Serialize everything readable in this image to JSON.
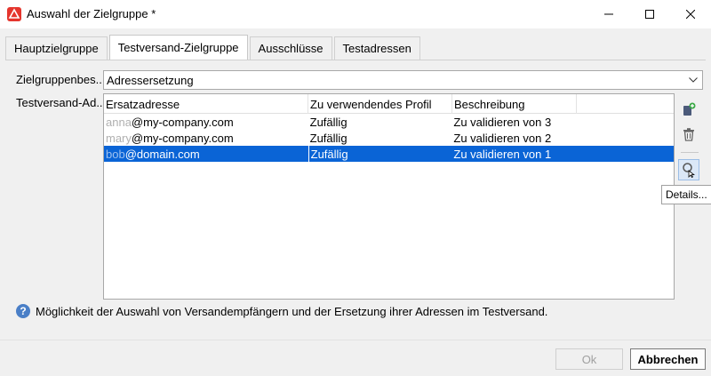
{
  "window": {
    "title": "Auswahl der Zielgruppe *",
    "logo_icon": "adobe-campaign-icon",
    "accent": "#e5352d"
  },
  "tabs": [
    {
      "label": "Hauptzielgruppe",
      "active": false
    },
    {
      "label": "Testversand-Zielgruppe",
      "active": true
    },
    {
      "label": "Ausschlüsse",
      "active": false
    },
    {
      "label": "Testadressen",
      "active": false
    }
  ],
  "form": {
    "target_label": "Zielgruppenbes...",
    "target_value": "Adressersetzung",
    "testaddress_label": "Testversand-Ad..."
  },
  "grid": {
    "columns": [
      "Ersatzadresse",
      "Zu verwendendes Profil",
      "Beschreibung"
    ],
    "rows": [
      {
        "masked": "anna",
        "domain": "@my-company.com",
        "profile": "Zufällig",
        "description": "Zu validieren von 3",
        "selected": false
      },
      {
        "masked": "mary",
        "domain": "@my-company.com",
        "profile": "Zufällig",
        "description": "Zu validieren von 2",
        "selected": false
      },
      {
        "masked": "bob",
        "domain": "@domain.com",
        "profile": "Zufällig",
        "description": "Zu validieren von 1",
        "selected": true
      }
    ],
    "selection_color": "#0a64d6"
  },
  "side_tools": {
    "add_icon": "add-person-icon",
    "delete_icon": "trash-icon",
    "details_icon": "magnifier-details-icon",
    "tooltip": "Details..."
  },
  "info": {
    "icon": "question-icon",
    "text": "Möglichkeit der Auswahl von Versandempfängern und der Ersetzung ihrer Adressen im Testversand."
  },
  "buttons": {
    "ok": "Ok",
    "cancel": "Abbrechen"
  }
}
